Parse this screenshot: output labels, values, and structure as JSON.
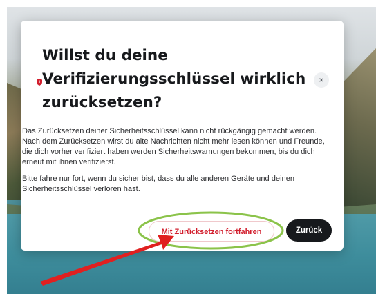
{
  "dialog": {
    "title_lines": [
      "Willst du deine",
      "Verifizierungsschlüssel wirklich",
      "zurücksetzen?"
    ],
    "close_icon": "close-icon",
    "title_icon": "shield-icon",
    "paragraphs": [
      "Das Zurücksetzen deiner Sicherheitsschlüssel kann nicht rückgängig gemacht werden. Nach dem Zurücksetzen wirst du alte Nachrichten nicht mehr lesen können und Freunde, die dich vorher verifiziert haben werden Sicherheitswarnungen bekommen, bis du dich erneut mit ihnen verifizierst.",
      "Bitte fahre nur fort, wenn du sicher bist, dass du alle anderen Geräte und deinen Sicherheitsschlüssel verloren hast."
    ],
    "buttons": {
      "continue_label": "Mit Zurücksetzen fortfahren",
      "back_label": "Zurück"
    }
  },
  "colors": {
    "danger": "#d21f2e",
    "primary_dark": "#17191c",
    "highlight_ellipse": "#8bc34a",
    "arrow": "#e02020"
  },
  "close_symbol": "×"
}
